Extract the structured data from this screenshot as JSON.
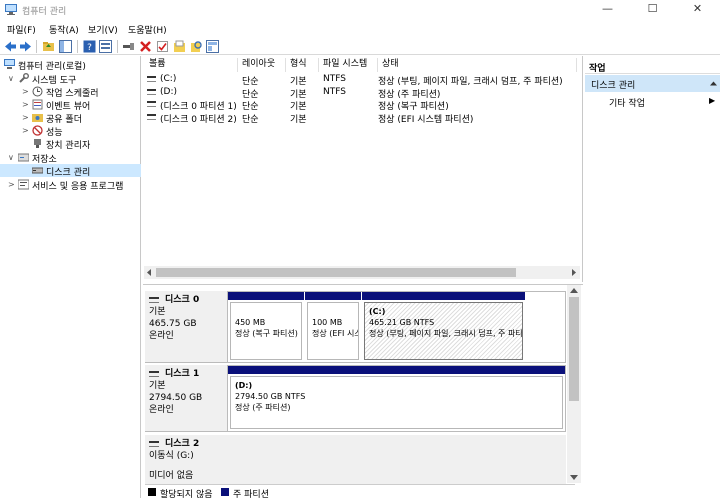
{
  "window": {
    "title": "컴퓨터 관리",
    "controls": {
      "minimize": "—",
      "maximize": "☐",
      "close": "✕"
    }
  },
  "menu": [
    "파일(F)",
    "동작(A)",
    "보기(V)",
    "도움말(H)"
  ],
  "toolbar_icons": [
    "back-icon",
    "forward-icon",
    "up-folder-icon",
    "show-tree-icon",
    "help-icon",
    "properties-icon",
    "connect-icon",
    "delete-icon",
    "check-icon",
    "open-icon",
    "search-icon",
    "refresh-icon"
  ],
  "tree": [
    {
      "label": "컴퓨터 관리(로컬)",
      "level": 0,
      "expander": "",
      "icon": "computer-icon"
    },
    {
      "label": "시스템 도구",
      "level": 1,
      "expander": "∨",
      "icon": "tools-icon"
    },
    {
      "label": "작업 스케줄러",
      "level": 2,
      "expander": ">",
      "icon": "scheduler-icon"
    },
    {
      "label": "이벤트 뷰어",
      "level": 2,
      "expander": ">",
      "icon": "event-viewer-icon"
    },
    {
      "label": "공유 폴더",
      "level": 2,
      "expander": ">",
      "icon": "shared-folder-icon"
    },
    {
      "label": "성능",
      "level": 2,
      "expander": ">",
      "icon": "performance-icon"
    },
    {
      "label": "장치 관리자",
      "level": 2,
      "expander": "",
      "icon": "device-manager-icon"
    },
    {
      "label": "저장소",
      "level": 1,
      "expander": "∨",
      "icon": "storage-icon"
    },
    {
      "label": "디스크 관리",
      "level": 2,
      "expander": "",
      "icon": "disk-icon",
      "selected": true
    },
    {
      "label": "서비스 및 응용 프로그램",
      "level": 1,
      "expander": ">",
      "icon": "services-icon"
    }
  ],
  "list": {
    "columns": [
      "볼륨",
      "레이아웃",
      "형식",
      "파일 시스템",
      "상태"
    ],
    "rows": [
      [
        "(C:)",
        "단순",
        "기본",
        "NTFS",
        "정상 (부팅, 페이지 파일, 크래시 덤프, 주 파티션)"
      ],
      [
        "(D:)",
        "단순",
        "기본",
        "NTFS",
        "정상 (주 파티션)"
      ],
      [
        "(디스크 0 파티션 1)",
        "단순",
        "기본",
        "",
        "정상 (복구 파티션)"
      ],
      [
        "(디스크 0 파티션 2)",
        "단순",
        "기본",
        "",
        "정상 (EFI 시스템 파티션)"
      ]
    ]
  },
  "disks": [
    {
      "name": "디스크 0",
      "type": "기본",
      "size": "465.75 GB",
      "status": "온라인",
      "partitions": [
        {
          "title": "",
          "size": "450 MB",
          "status": "정상 (복구 파티션)"
        },
        {
          "title": "",
          "size": "100 MB",
          "status": "정상 (EFI 시스템 파티션)"
        },
        {
          "title": "(C:)",
          "size": "465.21 GB NTFS",
          "status": "정상 (부팅, 페이지 파일, 크래시 덤프, 주 파티션)"
        }
      ]
    },
    {
      "name": "디스크 1",
      "type": "기본",
      "size": "2794.50 GB",
      "status": "온라인",
      "partitions": [
        {
          "title": "(D:)",
          "size": "2794.50 GB NTFS",
          "status": "정상 (주 파티션)"
        }
      ]
    },
    {
      "name": "디스크 2",
      "type": "이동식 (G:)",
      "size": "",
      "status": "미디어 없음",
      "partitions": []
    }
  ],
  "legend": [
    {
      "label": "할당되지 않음",
      "color": "#000000"
    },
    {
      "label": "주 파티션",
      "color": "#0a107a"
    }
  ],
  "actions": {
    "header": "작업",
    "selected": "디스크 관리",
    "item": "기타 작업",
    "item_arrow": "▶"
  }
}
